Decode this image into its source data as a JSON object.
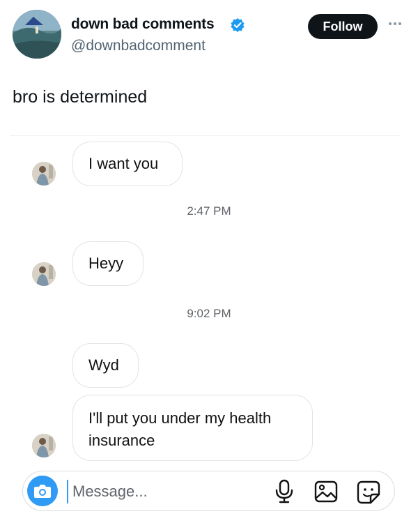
{
  "tweet": {
    "author_name": "down bad comments",
    "author_handle": "@downbadcomment",
    "verified": true,
    "follow_label": "Follow",
    "text": "bro is determined"
  },
  "dm": {
    "messages": [
      {
        "text": "I want you"
      },
      {
        "text": "Heyy"
      },
      {
        "text": "Wyd"
      },
      {
        "text": "I'll put you under my health insurance"
      }
    ],
    "timestamps": [
      "2:47 PM",
      "9:02 PM"
    ],
    "composer": {
      "placeholder": "Message...",
      "icons": [
        "camera-icon",
        "microphone-icon",
        "gallery-icon",
        "sticker-icon"
      ]
    }
  },
  "colors": {
    "follow_bg": "#0f1419",
    "verified_blue": "#1d9bf0",
    "camera_blue": "#2f9bf4",
    "handle_gray": "#536471"
  }
}
